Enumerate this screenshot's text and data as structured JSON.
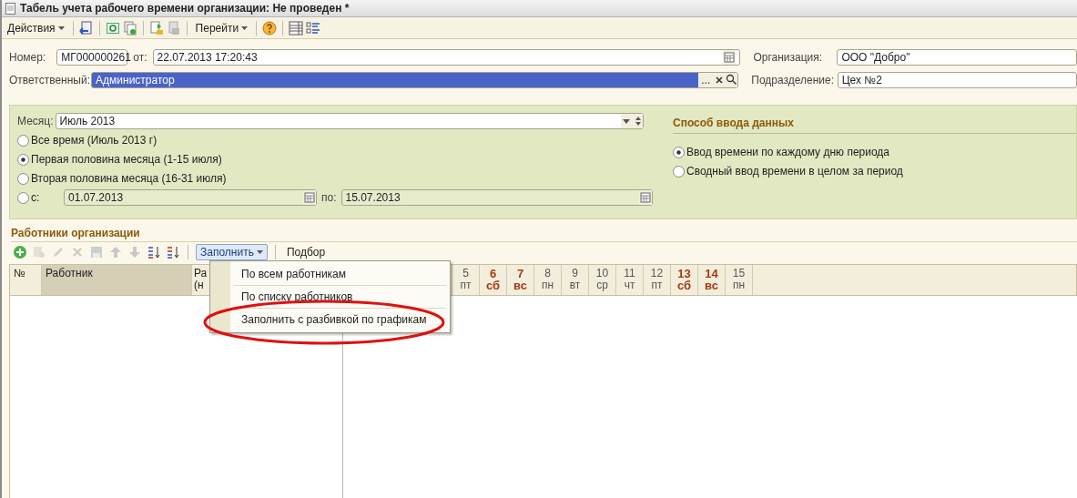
{
  "window": {
    "title": "Табель учета рабочего времени организации: Не проведен *"
  },
  "toolbar": {
    "actions_menu": "Действия",
    "goto_menu": "Перейти"
  },
  "header": {
    "number_label": "Номер:",
    "number": "МГ000000261",
    "date_label": "от:",
    "date": "22.07.2013 17:20:43",
    "responsible_label": "Ответственный:",
    "responsible": "Администратор",
    "responsible_selected": true,
    "choose_button": "...",
    "organization_label": "Организация:",
    "organization": "ООО \"Добро\"",
    "division_label": "Подразделение:",
    "division": "Цех №2"
  },
  "period": {
    "month_label": "Месяц:",
    "month": "Июль 2013",
    "options": [
      {
        "label": "Все время (Июль 2013 г)",
        "selected": false
      },
      {
        "label": "Первая половина месяца (1-15 июля)",
        "selected": true
      },
      {
        "label": "Вторая половина месяца (16-31 июля)",
        "selected": false
      }
    ],
    "range": {
      "label": "с:",
      "selected": false,
      "from": "01.07.2013",
      "to_label": "по:",
      "to": "15.07.2013",
      "disabled": true
    }
  },
  "input_method": {
    "title": "Способ ввода данных",
    "options": [
      {
        "label": "Ввод времени по каждому дню периода",
        "selected": true
      },
      {
        "label": "Сводный ввод времени в целом за период",
        "selected": false
      }
    ]
  },
  "employees": {
    "title": "Работники организации",
    "fill_button": {
      "label": "Заполнить",
      "expanded": true
    },
    "pick_button": "Подбор",
    "columns": [
      {
        "lines": [
          "№"
        ],
        "selected": false
      },
      {
        "lines": [
          "Работник"
        ],
        "selected": true
      },
      {
        "lines": [
          "Ра",
          "(н"
        ],
        "selected": false
      }
    ],
    "days": [
      {
        "day": "5",
        "weekday": "пт",
        "weekend": false
      },
      {
        "day": "6",
        "weekday": "сб",
        "weekend": true
      },
      {
        "day": "7",
        "weekday": "вс",
        "weekend": true
      },
      {
        "day": "8",
        "weekday": "пн",
        "weekend": false
      },
      {
        "day": "9",
        "weekday": "вт",
        "weekend": false
      },
      {
        "day": "10",
        "weekday": "ср",
        "weekend": false
      },
      {
        "day": "11",
        "weekday": "чт",
        "weekend": false
      },
      {
        "day": "12",
        "weekday": "пт",
        "weekend": false
      },
      {
        "day": "13",
        "weekday": "сб",
        "weekend": true
      },
      {
        "day": "14",
        "weekday": "вс",
        "weekend": true
      },
      {
        "day": "15",
        "weekday": "пн",
        "weekend": false
      }
    ],
    "fill_menu": [
      {
        "label": "По всем работникам",
        "circled": false
      },
      {
        "label": "По списку работников",
        "circled": false
      },
      {
        "label": "Заполнить с разбивкой по графикам",
        "circled": true
      }
    ]
  }
}
